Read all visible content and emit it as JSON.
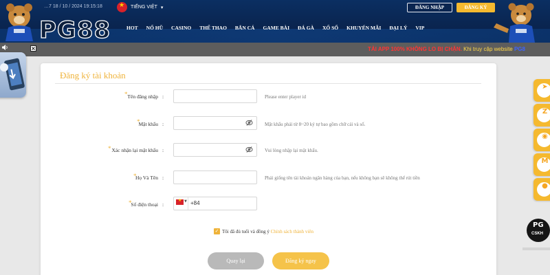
{
  "header": {
    "clock": "…7 18 / 10 / 2024 19:15:18",
    "language": "TIẾNG VIỆT",
    "logo": "PG88",
    "login_label": "ĐĂNG NHẬP",
    "register_label": "ĐĂNG KÝ",
    "nav": [
      "HOT",
      "NỔ HŨ",
      "CASINO",
      "THỂ THAO",
      "BẮN CÁ",
      "GAME BÀI",
      "ĐÁ GÀ",
      "XỔ SỐ",
      "KHUYẾN MÃI",
      "ĐẠI LÝ",
      "VIP"
    ]
  },
  "marquee": {
    "red_text": "TẢI APP 100% KHÔNG LO BỊ CHẶN.",
    "yellow_text": " Khi truy cập website ",
    "blue_text": "PG8"
  },
  "form": {
    "title": "Đăng ký tài khoản",
    "fields": [
      {
        "label": "Tên đăng nhập",
        "hint": "Please enter player id",
        "value": ""
      },
      {
        "label": "Mật khẩu",
        "hint": "Mật khẩu phải từ 8~20 ký tự bao gồm chữ cái và số.",
        "value": ""
      },
      {
        "label": "Xác nhận lại mật khẩu",
        "hint": "Vui lòng nhập lại mật khẩu.",
        "value": ""
      },
      {
        "label": "Họ Và Tên",
        "hint": "Phải giống tên tài khoản ngân hàng của bạn, nếu không bạn sẽ không thể rút tiền",
        "value": ""
      },
      {
        "label": "Số điện thoại",
        "hint": "",
        "value": ""
      }
    ],
    "colon": ":",
    "phone_code": "+84",
    "agree_text": "Tôi đã đủ tuổi và đồng ý ",
    "agree_link": "Chính sách thành viên",
    "agree_checked": true,
    "back_label": "Quay lại",
    "submit_label": "Đăng ký ngay"
  },
  "sidebar": {
    "items": [
      {
        "icon": "telegram-icon",
        "glyph": "➤"
      },
      {
        "icon": "zalo-icon",
        "glyph": "Z"
      },
      {
        "icon": "messenger-icon",
        "glyph": "◉"
      },
      {
        "icon": "gmail-icon",
        "glyph": "M"
      },
      {
        "icon": "chat-icon",
        "glyph": "●"
      }
    ],
    "cskh_logo": "PG",
    "cskh_label": "CSKH"
  },
  "colors": {
    "accent": "#f5b92f",
    "header_bg": "#0a2550",
    "marquee_bg": "#5d5d5d",
    "title": "#efb33a"
  }
}
